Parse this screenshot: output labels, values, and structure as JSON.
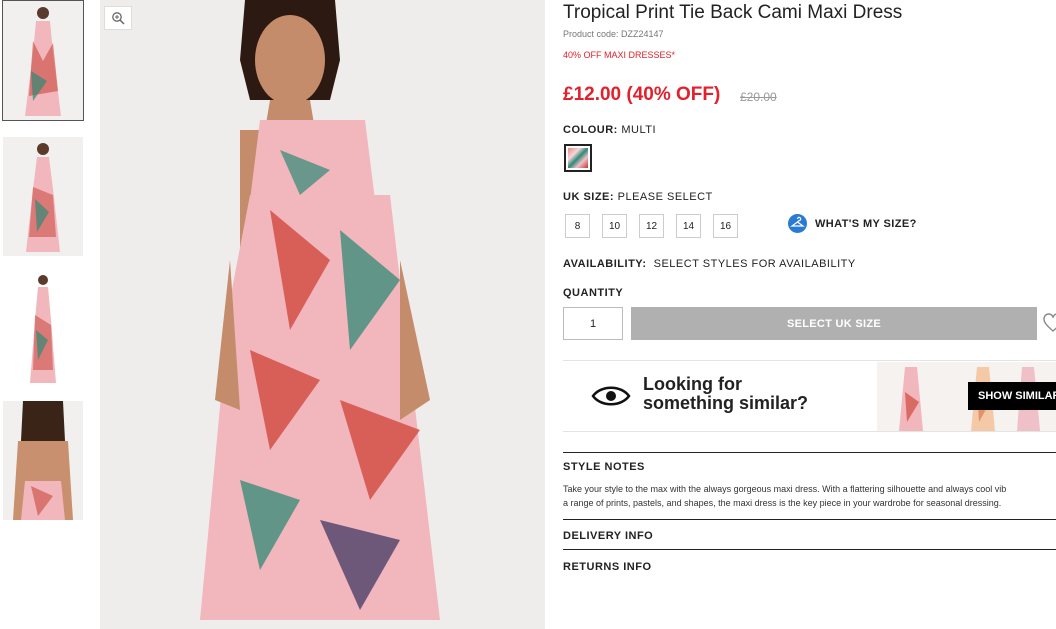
{
  "product": {
    "title": "Tropical Print Tie Back Cami Maxi Dress",
    "code": "Product code: DZZ24147",
    "promo": "40% OFF MAXI DRESSES*",
    "price": "£12.00 (40% OFF)",
    "was_price": "£20.00"
  },
  "colour": {
    "label": "COLOUR:",
    "value": "MULTI",
    "swatch_name": "multi"
  },
  "size": {
    "label": "UK SIZE:",
    "value": "PLEASE SELECT",
    "options": [
      "8",
      "10",
      "12",
      "14",
      "16"
    ],
    "whats_my_size": "WHAT'S MY SIZE?"
  },
  "availability": {
    "label": "AVAILABILITY:",
    "value": "SELECT STYLES FOR AVAILABILITY"
  },
  "quantity": {
    "label": "QUANTITY",
    "value": "1"
  },
  "add_button": "SELECT UK SIZE",
  "similar": {
    "line1": "Looking for",
    "line2": "something similar?",
    "button": "SHOW SIMILAR"
  },
  "style_notes": {
    "heading": "STYLE NOTES",
    "line1": "Take your style to the max with the always gorgeous maxi dress. With a flattering silhouette and always cool vib",
    "line2": "a range of prints, pastels, and shapes, the maxi dress is the key piece in your wardrobe for seasonal dressing."
  },
  "delivery": "DELIVERY INFO",
  "returns": "RETURNS INFO",
  "colors": {
    "sale_red": "#e3202c",
    "button_grey": "#b0b0b0",
    "size_icon_blue": "#2a7ad4"
  },
  "icons": [
    "zoom-icon",
    "hanger-icon",
    "heart-icon",
    "eye-icon"
  ]
}
